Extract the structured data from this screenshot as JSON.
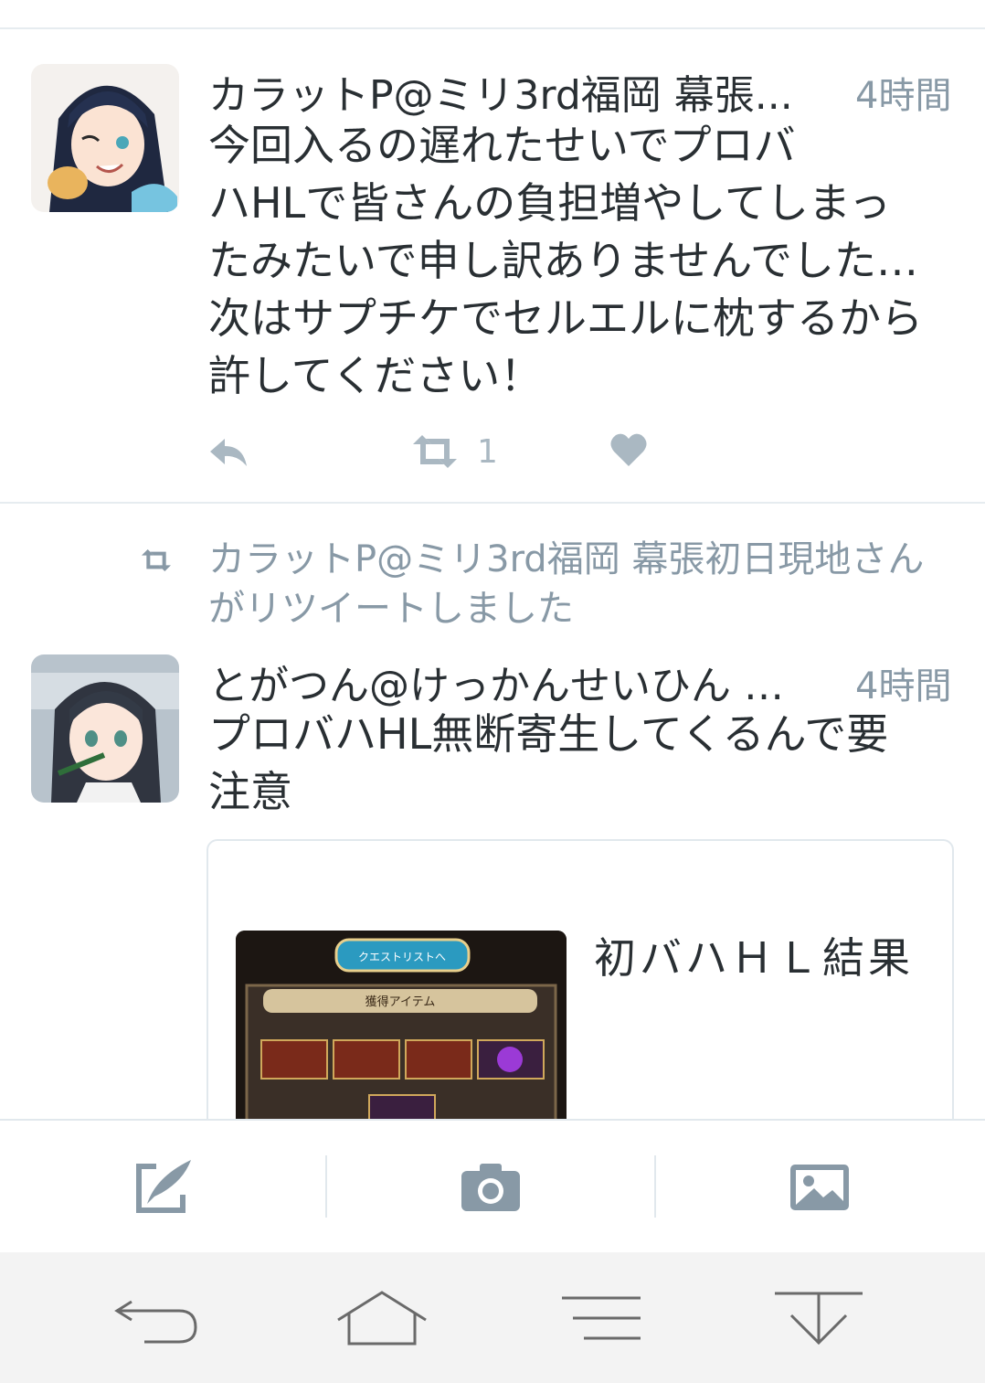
{
  "tweets": [
    {
      "author": "カラットP@ミリ3rd福岡 幕張...",
      "time": "4時間",
      "lines": [
        "今回入るの遅れたせいでプロバ",
        "ハHLで皆さんの負担増やしてしまっ",
        "たみたいで申し訳ありませんでした…",
        "次はサプチケでセルエルに枕するから",
        "許してください！"
      ],
      "actions": {
        "retweet_count": "1"
      }
    },
    {
      "retweet_notice": [
        "カラットP@ミリ3rd福岡 幕張初日現地さん",
        "がリツイートしました"
      ],
      "author": "とがつん@けっかんせいひん …",
      "time": "4時間",
      "lines": [
        "プロバハHL無断寄生してくるんで要",
        "注意"
      ],
      "card": {
        "title": "初バハＨＬ結果",
        "thumb_button": "クエストリストへ",
        "thumb_header": "獲得アイテム"
      }
    }
  ],
  "colors": {
    "icon_gray": "#8899a6",
    "light_gray": "#aab8c2",
    "text": "#292f33",
    "divider": "#e6ecf0"
  },
  "composer": {
    "icons": [
      "compose-icon",
      "camera-icon",
      "image-icon"
    ]
  },
  "navbar": {
    "icons": [
      "back-icon",
      "home-icon",
      "menu-icon",
      "notification-pulldown-icon"
    ]
  }
}
